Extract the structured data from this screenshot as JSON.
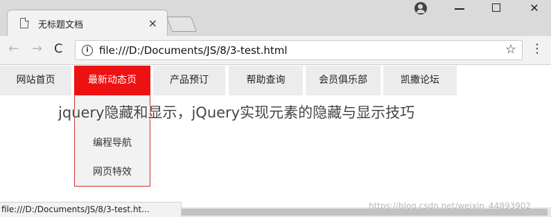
{
  "browser": {
    "tab_title": "无标题文档",
    "tab_close": "×",
    "window_controls": {
      "minimize": "minimize-icon",
      "maximize": "maximize-icon",
      "close": "✕"
    },
    "profile_icon": "profile-icon",
    "nav": {
      "back": "←",
      "forward": "→",
      "reload": "C"
    },
    "info_icon": "i",
    "url": "file:///D:/Documents/JS/8/3-test.html",
    "star": "☆",
    "menu_icon": "⋮"
  },
  "page": {
    "menu": [
      {
        "label": "网站首页"
      },
      {
        "label": "最新动态页",
        "active": true
      },
      {
        "label": "产品预订"
      },
      {
        "label": "帮助查询"
      },
      {
        "label": "会员俱乐部"
      },
      {
        "label": "凯撒论坛"
      }
    ],
    "dropdown": [
      "编程导航",
      "网页特效"
    ],
    "overlay_text": "jquery隐藏和显示，jQuery实现元素的隐藏与显示技巧"
  },
  "status_bar": {
    "url": "file:///D:/Documents/JS/8/3-test.ht..."
  },
  "watermark": "https://blog.csdn.net/weixin_44893902",
  "colors": {
    "active_menu": "#ee1111",
    "menu_bg": "#ececec",
    "tab_bg": "#f2f2f2",
    "strip_bg": "#dadada"
  }
}
